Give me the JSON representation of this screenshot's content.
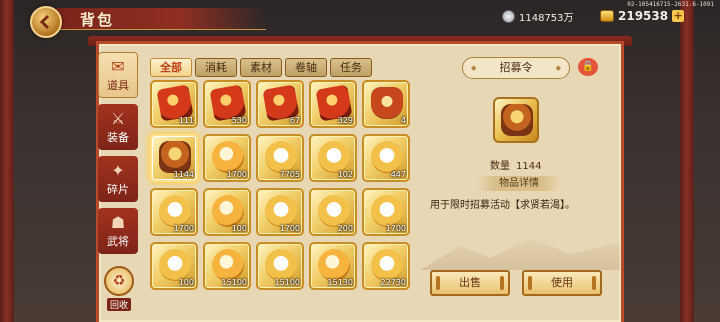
{
  "header": {
    "title": "背包",
    "coord_text": "02-105416715-2631.6-1091",
    "silver": "1148753万",
    "gold": "219538"
  },
  "side_tabs": [
    {
      "label": "道具",
      "icon": "scroll-icon",
      "active": true
    },
    {
      "label": "装备",
      "icon": "armor-icon",
      "active": false
    },
    {
      "label": "碎片",
      "icon": "puzzle-icon",
      "active": false
    },
    {
      "label": "武将",
      "icon": "general-icon",
      "active": false
    }
  ],
  "recycle_label": "回收",
  "filter_tabs": [
    "全部",
    "消耗",
    "素材",
    "卷轴",
    "任务"
  ],
  "items": [
    {
      "count": "111",
      "kind": "red"
    },
    {
      "count": "530",
      "kind": "red"
    },
    {
      "count": "67",
      "kind": "red"
    },
    {
      "count": "329",
      "kind": "red"
    },
    {
      "count": "4",
      "kind": "redseal"
    },
    {
      "count": "1144",
      "kind": "general",
      "selected": true
    },
    {
      "count": "1700",
      "kind": "gold"
    },
    {
      "count": "7705",
      "kind": "goldwhite"
    },
    {
      "count": "102",
      "kind": "goldwhite"
    },
    {
      "count": "447",
      "kind": "goldwhite"
    },
    {
      "count": "1700",
      "kind": "goldwhite"
    },
    {
      "count": "100",
      "kind": "gold"
    },
    {
      "count": "1700",
      "kind": "goldwhite"
    },
    {
      "count": "200",
      "kind": "goldwhite"
    },
    {
      "count": "1700",
      "kind": "goldwhite"
    },
    {
      "count": "100",
      "kind": "goldwhite"
    },
    {
      "count": "15100",
      "kind": "gold"
    },
    {
      "count": "15100",
      "kind": "goldwhite"
    },
    {
      "count": "15130",
      "kind": "gold"
    },
    {
      "count": "22730",
      "kind": "goldwhite"
    }
  ],
  "detail": {
    "name": "招募令",
    "qty_label": "数量",
    "qty_value": "1144",
    "info_label": "物品详情",
    "description": "用于限时招募活动【求贤若渴】。",
    "sell_label": "出售",
    "use_label": "使用"
  },
  "colors": {
    "accent_red": "#b94a2c",
    "gold": "#f1cf69",
    "panel": "#e7d7b4"
  }
}
